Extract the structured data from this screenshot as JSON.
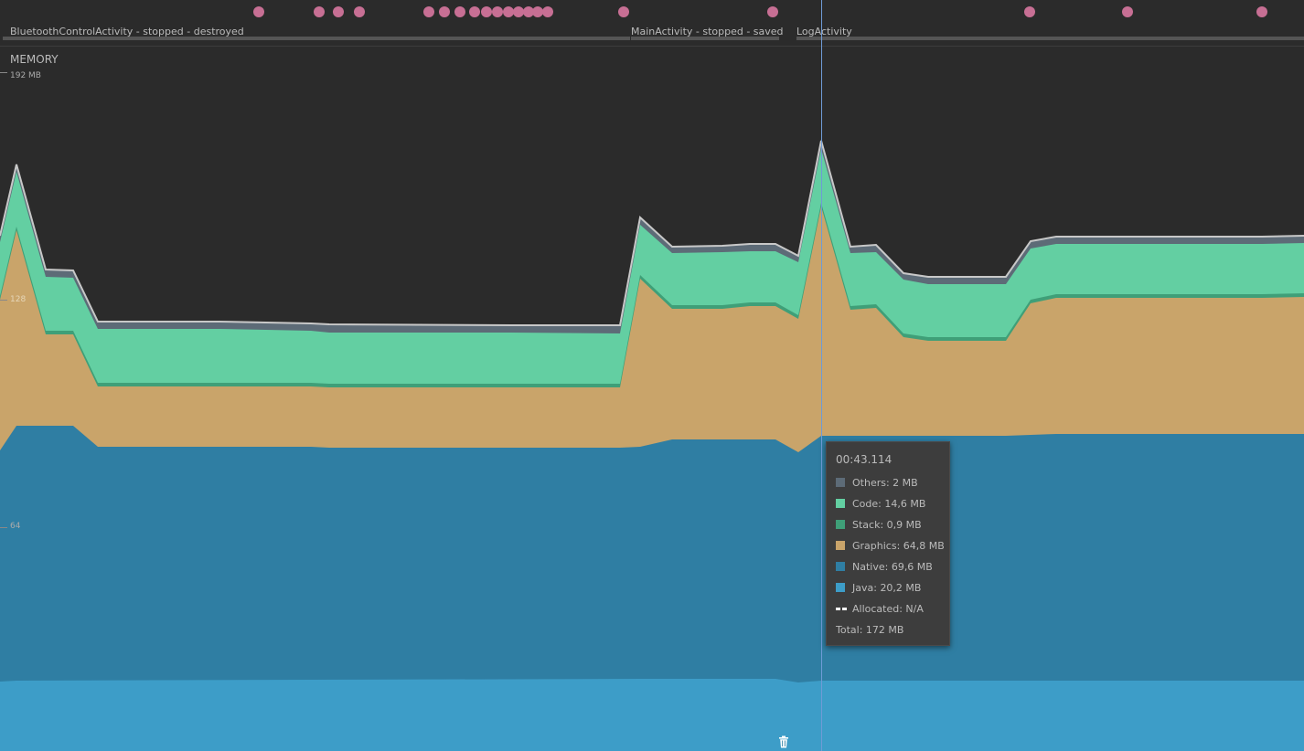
{
  "events": {
    "activities": [
      {
        "label": "BluetoothControlActivity - stopped - destroyed"
      },
      {
        "label": "MainActivity - stopped - saved"
      },
      {
        "label": "LogActivity"
      }
    ]
  },
  "memory": {
    "title": "MEMORY",
    "ticks": [
      "192 MB",
      "128",
      "64"
    ]
  },
  "tooltip": {
    "time": "00:43.114",
    "rows": [
      {
        "label": "Others: 2 MB",
        "color": "#5d6b77"
      },
      {
        "label": "Code: 14,6 MB",
        "color": "#63cfa2"
      },
      {
        "label": "Stack: 0,9 MB",
        "color": "#3f9f78"
      },
      {
        "label": "Graphics: 64,8 MB",
        "color": "#c9a46a"
      },
      {
        "label": "Native: 69,6 MB",
        "color": "#2f7ea3"
      },
      {
        "label": "Java: 20,2 MB",
        "color": "#3d9dc8"
      },
      {
        "label": "Allocated: N/A",
        "color": "#ffffff"
      },
      {
        "label": "Total: 172 MB"
      }
    ]
  },
  "colors": {
    "background": "#2b2b2b",
    "others": "#5d6b77",
    "code": "#63cfa2",
    "stack": "#3f9f78",
    "graphics": "#c9a46a",
    "native": "#2f7ea3",
    "java": "#3d9dc8",
    "event_dot": "#c76f94",
    "cursor": "#6f9bd6"
  },
  "icons": {
    "gc": "trash-icon"
  }
}
